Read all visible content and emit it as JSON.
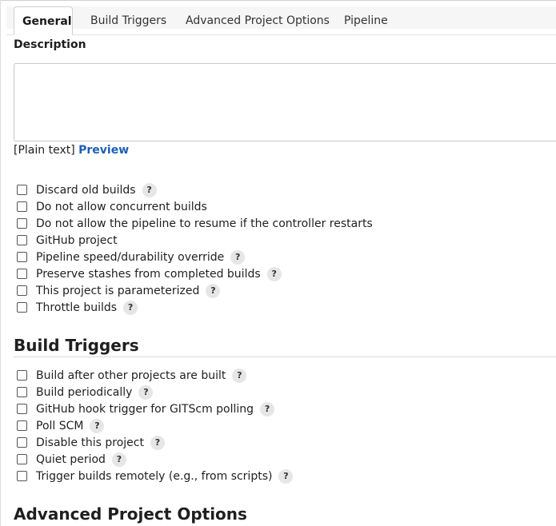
{
  "tabs": [
    "General",
    "Build Triggers",
    "Advanced Project Options",
    "Pipeline"
  ],
  "general": {
    "description_label": "Description",
    "description_value": "",
    "plain_text": "[Plain text]",
    "preview_link": "Preview",
    "options": [
      {
        "label": "Discard old builds",
        "help": "?"
      },
      {
        "label": "Do not allow concurrent builds"
      },
      {
        "label": "Do not allow the pipeline to resume if the controller restarts"
      },
      {
        "label": "GitHub project"
      },
      {
        "label": "Pipeline speed/durability override",
        "help": "?"
      },
      {
        "label": "Preserve stashes from completed builds",
        "help": "?"
      },
      {
        "label": "This project is parameterized",
        "help": "?"
      },
      {
        "label": "Throttle builds",
        "help": "?"
      }
    ]
  },
  "build_triggers": {
    "title": "Build Triggers",
    "options": [
      {
        "label": "Build after other projects are built",
        "help": "?"
      },
      {
        "label": "Build periodically",
        "help": "?"
      },
      {
        "label": "GitHub hook trigger for GITScm polling",
        "help": "?"
      },
      {
        "label": "Poll SCM",
        "help": "?"
      },
      {
        "label": "Disable this project",
        "help": "?"
      },
      {
        "label": "Quiet period",
        "help": "?"
      },
      {
        "label": "Trigger builds remotely (e.g., from scripts)",
        "help": "?"
      }
    ]
  },
  "advanced": {
    "title": "Advanced Project Options"
  }
}
